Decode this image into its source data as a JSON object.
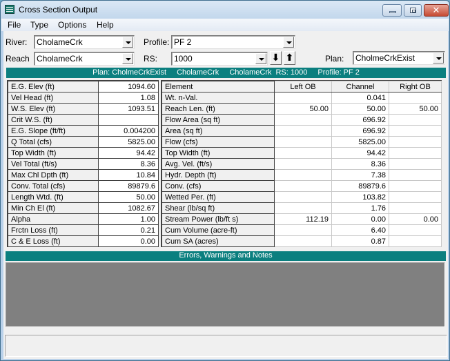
{
  "window": {
    "title": "Cross Section Output",
    "icon": "table-grid-icon",
    "controls": {
      "minimize": "minimize-icon",
      "maximize": "maximize-icon",
      "close": "close-icon",
      "close_glyph": "✕"
    }
  },
  "menu": [
    "File",
    "Type",
    "Options",
    "Help"
  ],
  "selectors": {
    "river": {
      "label": "River:",
      "value": "CholameCrk"
    },
    "reach": {
      "label": "Reach",
      "value": "CholameCrk"
    },
    "profile": {
      "label": "Profile:",
      "value": "PF 2"
    },
    "rs": {
      "label": "RS:",
      "value": "1000",
      "down_glyph": "⬇",
      "up_glyph": "⬆"
    },
    "plan": {
      "label": "Plan:",
      "value": "CholmeCrkExist"
    }
  },
  "plan_header": {
    "plan": "Plan: CholmeCrkExist",
    "river": "CholameCrk",
    "reach": "CholameCrk",
    "rs": "RS: 1000",
    "profile": "Profile: PF 2"
  },
  "summary_table": [
    {
      "label": "E.G. Elev (ft)",
      "value": "1094.60"
    },
    {
      "label": "Vel Head (ft)",
      "value": "1.08"
    },
    {
      "label": "W.S. Elev (ft)",
      "value": "1093.51"
    },
    {
      "label": "Crit W.S. (ft)",
      "value": ""
    },
    {
      "label": "E.G. Slope (ft/ft)",
      "value": "0.004200"
    },
    {
      "label": "Q Total (cfs)",
      "value": "5825.00"
    },
    {
      "label": "Top Width (ft)",
      "value": "94.42"
    },
    {
      "label": "Vel Total (ft/s)",
      "value": "8.36"
    },
    {
      "label": "Max Chl Dpth (ft)",
      "value": "10.84"
    },
    {
      "label": "Conv. Total (cfs)",
      "value": "89879.6"
    },
    {
      "label": "Length Wtd. (ft)",
      "value": "50.00"
    },
    {
      "label": "Min Ch El (ft)",
      "value": "1082.67"
    },
    {
      "label": "Alpha",
      "value": "1.00"
    },
    {
      "label": "Frctn Loss (ft)",
      "value": "0.21"
    },
    {
      "label": "C & E Loss (ft)",
      "value": "0.00"
    }
  ],
  "element_table": {
    "headers": [
      "Element",
      "Left OB",
      "Channel",
      "Right OB"
    ],
    "rows": [
      {
        "label": "Wt. n-Val.",
        "left": "",
        "channel": "0.041",
        "right": ""
      },
      {
        "label": "Reach Len. (ft)",
        "left": "50.00",
        "channel": "50.00",
        "right": "50.00"
      },
      {
        "label": "Flow Area (sq ft)",
        "left": "",
        "channel": "696.92",
        "right": ""
      },
      {
        "label": "Area (sq ft)",
        "left": "",
        "channel": "696.92",
        "right": ""
      },
      {
        "label": "Flow (cfs)",
        "left": "",
        "channel": "5825.00",
        "right": ""
      },
      {
        "label": "Top Width (ft)",
        "left": "",
        "channel": "94.42",
        "right": ""
      },
      {
        "label": "Avg. Vel. (ft/s)",
        "left": "",
        "channel": "8.36",
        "right": ""
      },
      {
        "label": "Hydr. Depth (ft)",
        "left": "",
        "channel": "7.38",
        "right": ""
      },
      {
        "label": "Conv. (cfs)",
        "left": "",
        "channel": "89879.6",
        "right": ""
      },
      {
        "label": "Wetted Per. (ft)",
        "left": "",
        "channel": "103.82",
        "right": ""
      },
      {
        "label": "Shear (lb/sq ft)",
        "left": "",
        "channel": "1.76",
        "right": ""
      },
      {
        "label": "Stream Power (lb/ft s)",
        "left": "112.19",
        "channel": "0.00",
        "right": "0.00"
      },
      {
        "label": "Cum Volume (acre-ft)",
        "left": "",
        "channel": "6.40",
        "right": ""
      },
      {
        "label": "Cum SA (acres)",
        "left": "",
        "channel": "0.87",
        "right": ""
      }
    ]
  },
  "errors_panel": {
    "title": "Errors, Warnings and Notes",
    "content": ""
  },
  "status_bar": {
    "text": ""
  },
  "colors": {
    "header_teal": "#0b7f7f",
    "errors_bg": "#808080"
  }
}
